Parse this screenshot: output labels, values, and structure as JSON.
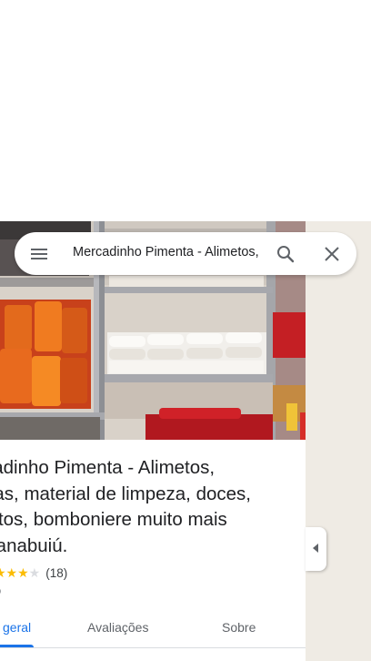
{
  "search": {
    "query": "Mercadinho Pimenta - Alimetos, bebidas, material de limpeza, doces, biscoitos, bomboniere muito mais em Banabuiú."
  },
  "place": {
    "title": "cadinho Pimenta - Alimetos,\ndas, material de limpeza, doces,\nbitos, bomboniere muito mais\nBanabuiú.",
    "rating_stars": "★★★",
    "rating_empty_star": "★",
    "rating": 3.5,
    "review_count": "(18)",
    "category": "o"
  },
  "tabs": [
    {
      "label": "geral"
    },
    {
      "label": "Avaliações"
    },
    {
      "label": "Sobre"
    }
  ],
  "icons": {
    "menu": "menu-icon",
    "search": "search-icon",
    "close": "close-icon",
    "collapse": "chevron-left-icon"
  },
  "colors": {
    "accent": "#1a73e8",
    "star": "#fbbc04",
    "map_background": "#efebe4",
    "text_primary": "#202124",
    "text_secondary": "#70757a"
  }
}
